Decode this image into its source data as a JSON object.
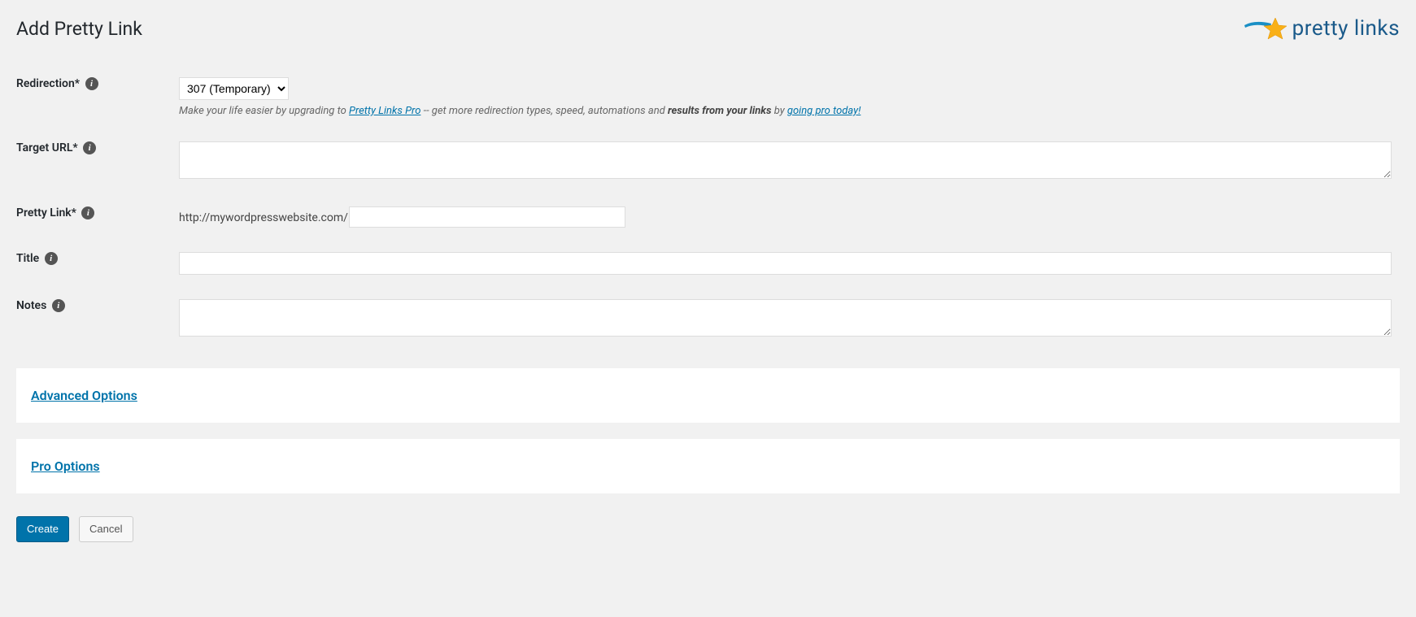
{
  "header": {
    "title": "Add Pretty Link",
    "logo_text": "pretty links"
  },
  "form": {
    "redirection": {
      "label": "Redirection*",
      "selected": "307 (Temporary)",
      "upgrade": {
        "prefix": "Make your life easier by upgrading to ",
        "link1": "Pretty Links Pro",
        "mid": " -- get more redirection types, speed, automations and ",
        "bold": "results from your links",
        "by": " by ",
        "link2": "going pro today!"
      }
    },
    "target_url": {
      "label": "Target URL*",
      "value": ""
    },
    "pretty_link": {
      "label": "Pretty Link*",
      "prefix": "http://mywordpresswebsite.com/",
      "value": ""
    },
    "title": {
      "label": "Title",
      "value": ""
    },
    "notes": {
      "label": "Notes",
      "value": ""
    }
  },
  "panels": {
    "advanced": "Advanced Options",
    "pro": "Pro Options"
  },
  "buttons": {
    "create": "Create",
    "cancel": "Cancel"
  }
}
